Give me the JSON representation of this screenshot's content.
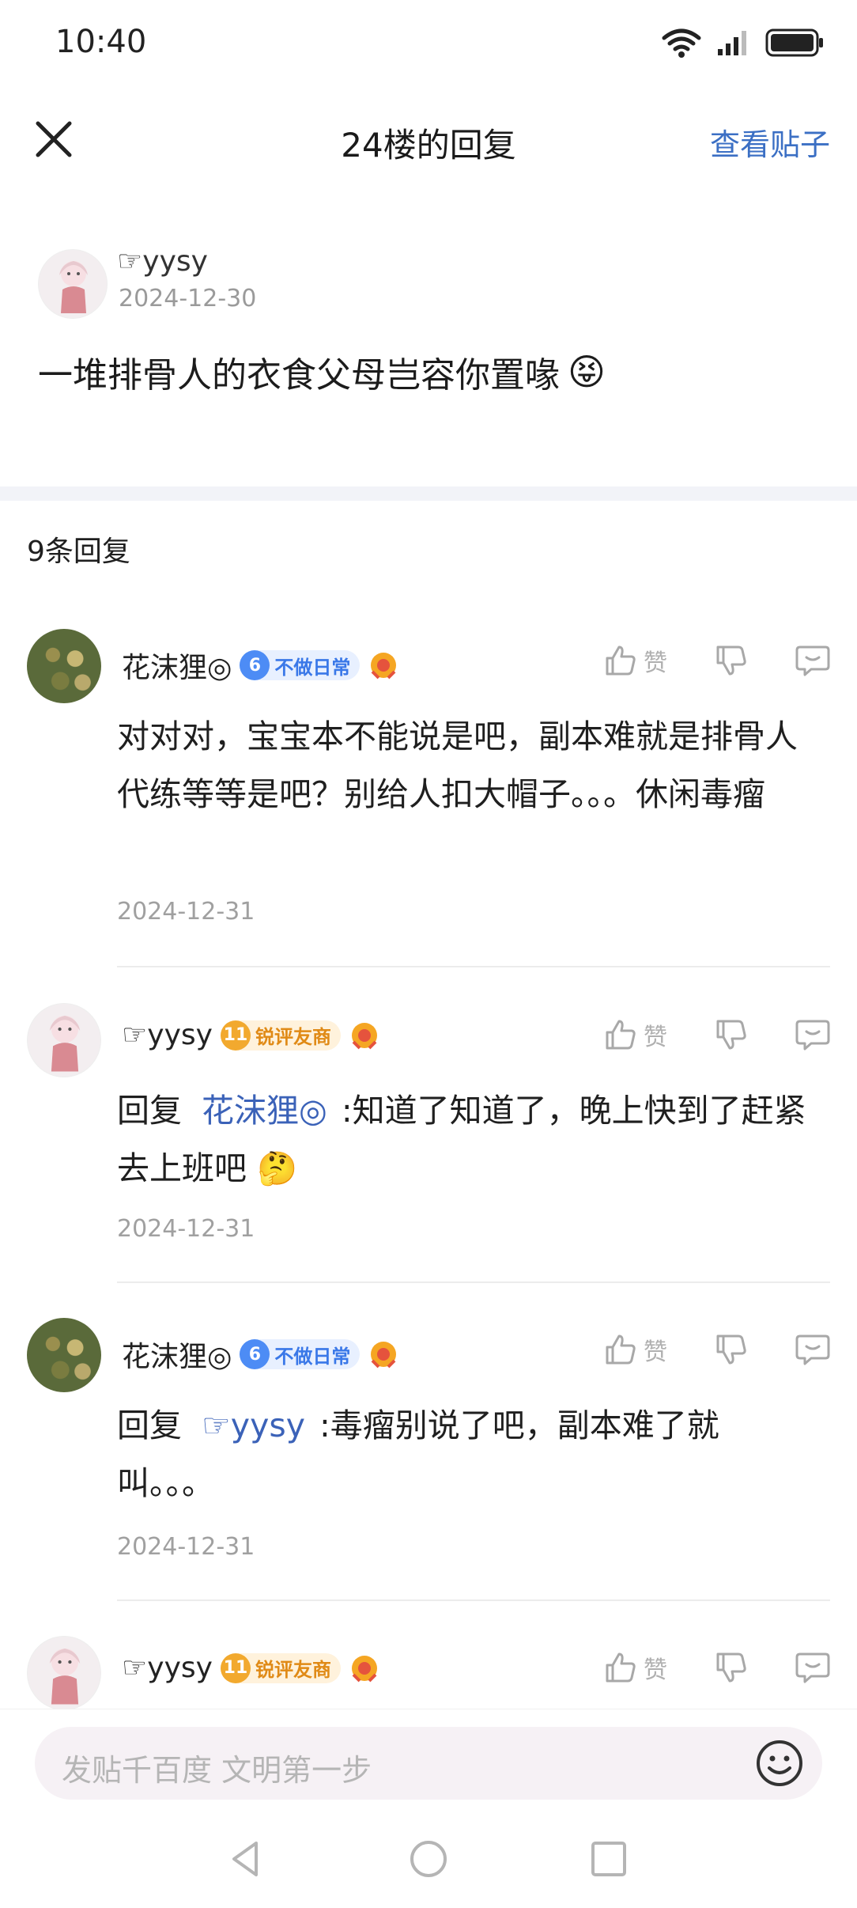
{
  "status": {
    "time": "10:40"
  },
  "header": {
    "title": "24楼的回复",
    "view_post": "查看贴子"
  },
  "post": {
    "author": "☞yysy",
    "date": "2024-12-30",
    "content": "一堆排骨人的衣食父母岂容你置喙",
    "emoji": "😝"
  },
  "reply_count": "9条回复",
  "replies": [
    {
      "author": "花沫狸◎",
      "level": "6",
      "badge": "不做日常",
      "like_label": "赞",
      "text": "对对对，宝宝本不能说是吧，副本难就是排骨人代练等等是吧？别给人扣大帽子。。。休闲毒瘤",
      "date": "2024-12-31"
    },
    {
      "author": "☞yysy",
      "level": "11",
      "badge": "锐评友商",
      "like_label": "赞",
      "prefix": "回复",
      "mention": "花沫狸◎",
      "text": ":知道了知道了，晚上快到了赶紧去上班吧",
      "emoji": "🤔",
      "date": "2024-12-31"
    },
    {
      "author": "花沫狸◎",
      "level": "6",
      "badge": "不做日常",
      "like_label": "赞",
      "prefix": "回复",
      "mention": "☞yysy",
      "text": ":毒瘤别说了吧，副本难了就叫。。。",
      "date": "2024-12-31"
    },
    {
      "author": "☞yysy",
      "level": "11",
      "badge": "锐评友商",
      "like_label": "赞"
    }
  ],
  "input": {
    "placeholder": "发贴千百度 文明第一步"
  },
  "colors": {
    "link": "#3b62b8",
    "accent_blue": "#3b6fc4",
    "badge_blue": "#4d8cf5",
    "badge_gold": "#f2a92e"
  }
}
